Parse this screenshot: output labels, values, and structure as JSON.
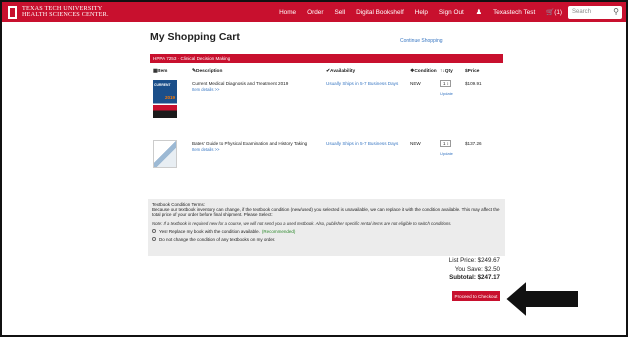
{
  "header": {
    "logo_line1": "TEXAS TECH UNIVERSITY",
    "logo_line2": "HEALTH SCIENCES CENTER.",
    "nav": [
      "Home",
      "Order",
      "Sell",
      "Digital Bookshelf",
      "Help",
      "Sign Out"
    ],
    "user_name": "Texastech Test",
    "cart_label": "(1)",
    "search_placeholder": "Search"
  },
  "page": {
    "title": "My Shopping Cart",
    "continue_link": "Continue Shopping"
  },
  "course": {
    "label": "HPPA 7253 · Clinical Decision Making"
  },
  "table": {
    "headers": [
      "Item",
      "Description",
      "Availability",
      "Condition",
      "Qty",
      "Price"
    ],
    "rows": [
      {
        "cover_label": "CURRENT",
        "cover_year": "2019",
        "title": "Current Medical Diagnosis and Treatment 2019",
        "link": "Item details >>",
        "availability": "Usually Ships in 5-7 Business Days",
        "condition": "NEW",
        "qty": "1",
        "update": "Update",
        "price": "$109.91"
      },
      {
        "title": "Bates' Guide to Physical Examination and History Taking",
        "link": "Item details >>",
        "availability": "Usually Ships in 5-7 Business Days",
        "condition": "NEW",
        "qty": "1",
        "update": "Update",
        "price": "$137.26"
      }
    ]
  },
  "terms": {
    "title": "Textbook Condition Terms:",
    "body": "Because our textbook inventory can change, if the textbook condition (new/used) you selected is unavailable, we can replace it with the condition available. This may affect the total price of your order before final shipment. Please Select:",
    "note": "Note: If a textbook is required new for a course, we will not send you a used textbook. Also, publisher specific rental items are not eligible to switch conditions.",
    "option1": "Yes! Replace my book with the condition available.",
    "option1_tag": "(Recommended)",
    "option2": "Do not change the condition of any textbooks on my order."
  },
  "totals": {
    "list_price": "List Price: $249.67",
    "you_save": "You Save: $2.50",
    "subtotal": "Subtotal: $247.17",
    "checkout": "Proceed to Checkout"
  },
  "colors": {
    "brand": "#c8102e",
    "link": "#3a78c3",
    "recommended": "#2d8a2d"
  }
}
